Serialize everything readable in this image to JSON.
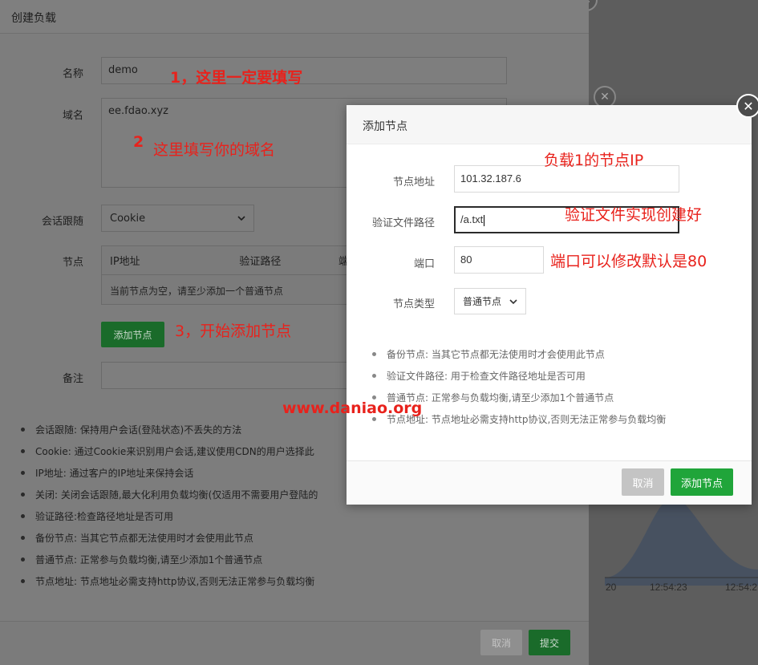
{
  "main_dialog": {
    "title": "创建负载",
    "fields": {
      "name_label": "名称",
      "name_value": "demo",
      "domain_label": "域名",
      "domain_value": "ee.fdao.xyz",
      "session_label": "会话跟随",
      "session_value": "Cookie",
      "node_label": "节点",
      "remark_label": "备注"
    },
    "node_table": {
      "columns": [
        "IP地址",
        "验证路径",
        "端"
      ],
      "empty_text": "当前节点为空，请至少添加一个普通节点"
    },
    "add_node_button": "添加节点",
    "tips": [
      "会话跟随: 保持用户会话(登陆状态)不丢失的方法",
      "Cookie: 通过Cookie来识别用户会话,建议使用CDN的用户选择此",
      "IP地址: 通过客户的IP地址来保持会话",
      "关闭: 关闭会话跟随,最大化利用负载均衡(仅适用不需要用户登陆的",
      "验证路径:检查路径地址是否可用",
      "备份节点: 当其它节点都无法使用时才会使用此节点",
      "普通节点: 正常参与负载均衡,请至少添加1个普通节点",
      "节点地址: 节点地址必需支持http协议,否则无法正常参与负载均衡"
    ],
    "cancel_button": "取消",
    "submit_button": "提交"
  },
  "modal": {
    "title": "添加节点",
    "address_label": "节点地址",
    "address_value": "101.32.187.6",
    "verify_label": "验证文件路径",
    "verify_value": "/a.txt",
    "port_label": "端口",
    "port_value": "80",
    "type_label": "节点类型",
    "type_value": "普通节点",
    "tips": [
      "备份节点: 当其它节点都无法使用时才会使用此节点",
      "验证文件路径: 用于检查文件路径地址是否可用",
      "普通节点: 正常参与负载均衡,请至少添加1个普通节点",
      "节点地址: 节点地址必需支持http协议,否则无法正常参与负载均衡"
    ],
    "cancel_button": "取消",
    "add_button": "添加节点"
  },
  "background": {
    "ticks": [
      "20",
      "12:54:23",
      "12:54:2"
    ]
  },
  "annotations": {
    "a1": "1，这里一定要填写",
    "a2_num": "2",
    "a2_text": "这里填写你的域名",
    "a3": "3，开始添加节点",
    "a4": "负载1的节点IP",
    "a5": "验证文件实现创建好",
    "a6": "端口可以修改默认是80",
    "watermark": "www.daniao.org"
  },
  "colors": {
    "accent_green": "#20a53a",
    "annotation_red": "#e8221c"
  }
}
